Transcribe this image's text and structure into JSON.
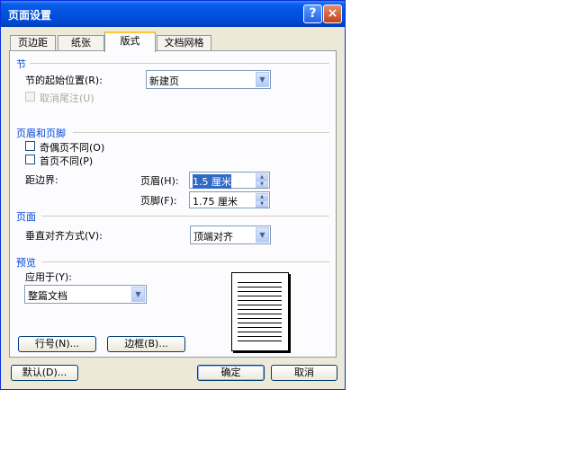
{
  "title": "页面设置",
  "titlebar_buttons": {
    "help": "?",
    "close": "×"
  },
  "tabs": [
    {
      "label": "页边距"
    },
    {
      "label": "纸张"
    },
    {
      "label": "版式",
      "active": true
    },
    {
      "label": "文档网格"
    }
  ],
  "section": {
    "heading": "节",
    "start_label": "节的起始位置(R):",
    "start_value": "新建页",
    "suppress_endnotes_label": "取消尾注(U)",
    "suppress_endnotes_checked": false,
    "suppress_endnotes_disabled": true
  },
  "headers_footers": {
    "heading": "页眉和页脚",
    "odd_even_label": "奇偶页不同(O)",
    "odd_even_checked": false,
    "first_page_label": "首页不同(P)",
    "first_page_checked": false,
    "from_edge_label": "距边界:",
    "header_label": "页眉(H):",
    "header_value": "1.5 厘米",
    "footer_label": "页脚(F):",
    "footer_value": "1.75 厘米"
  },
  "page": {
    "heading": "页面",
    "vertical_align_label": "垂直对齐方式(V):",
    "vertical_align_value": "顶端对齐"
  },
  "preview": {
    "heading": "预览",
    "apply_to_label": "应用于(Y):",
    "apply_to_value": "整篇文档"
  },
  "panel_buttons": {
    "line_numbers": "行号(N)...",
    "borders": "边框(B)..."
  },
  "footer_buttons": {
    "default": "默认(D)...",
    "ok": "确定",
    "cancel": "取消"
  },
  "colors": {
    "titlebar": "#0054e3",
    "group_label": "#0046d5",
    "selection": "#316ac5",
    "active_tab_accent": "#ffc83c"
  }
}
